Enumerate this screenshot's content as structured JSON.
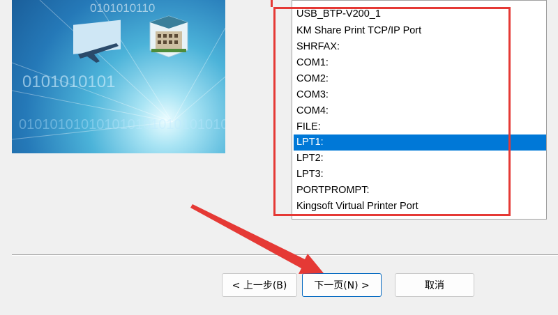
{
  "wizard_image": {
    "binary_top": "0101010110",
    "binary_mid": "0101010101",
    "binary_bottom": "010101010101010101010101010101"
  },
  "port_list": {
    "items": [
      "USB_BTP-V200_1",
      "KM Share Print TCP/IP Port",
      "SHRFAX:",
      "COM1:",
      "COM2:",
      "COM3:",
      "COM4:",
      "FILE:",
      "LPT1:",
      "LPT2:",
      "LPT3:",
      "PORTPROMPT:",
      "Kingsoft Virtual Printer Port"
    ],
    "selected": "LPT1:"
  },
  "buttons": {
    "back_label": "< 上一步(B)",
    "next_label": "下一页(N) >",
    "cancel_label": "取消"
  },
  "colors": {
    "selection": "#0078d7",
    "annotation": "#e53935",
    "default_button_border": "#0067c0"
  }
}
